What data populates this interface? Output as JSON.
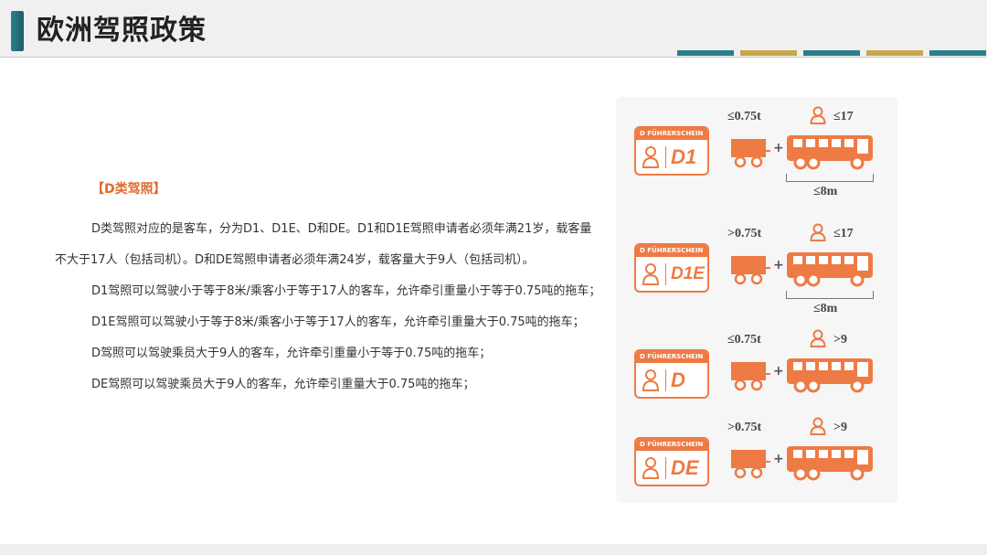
{
  "header": {
    "title": "欧洲驾照政策"
  },
  "stripes": [
    "#2a7f8a",
    "#c9a64a",
    "#2a7f8a",
    "#c9a64a",
    "#2a7f8a"
  ],
  "content": {
    "section_title": "【D类驾照】",
    "paragraphs": [
      "D类驾照对应的是客车，分为D1、D1E、D和DE。D1和D1E驾照申请者必须年满21岁，载客量不大于17人（包括司机）。D和DE驾照申请者必须年满24岁，载客量大于9人（包括司机）。",
      "D1驾照可以驾驶小于等于8米/乘客小于等于17人的客车，允许牵引重量小于等于0.75吨的拖车；",
      "D1E驾照可以驾驶小于等于8米/乘客小于等于17人的客车，允许牵引重量大于0.75吨的拖车；",
      "D驾照可以驾驶乘员大于9人的客车，允许牵引重量小于等于0.75吨的拖车；",
      "DE驾照可以驾驶乘员大于9人的客车，允许牵引重量大于0.75吨的拖车；"
    ]
  },
  "licenses": [
    {
      "header": "D  FÜHRERSCHEIN",
      "code": "D1",
      "trailer": "≤0.75t",
      "passengers": "≤17",
      "length": "≤8m"
    },
    {
      "header": "D  FÜHRERSCHEIN",
      "code": "D1E",
      "trailer": ">0.75t",
      "passengers": "≤17",
      "length": "≤8m"
    },
    {
      "header": "D  FÜHRERSCHEIN",
      "code": "D",
      "trailer": "≤0.75t",
      "passengers": ">9"
    },
    {
      "header": "D  FÜHRERSCHEIN",
      "code": "DE",
      "trailer": ">0.75t",
      "passengers": ">9"
    }
  ],
  "plus_sign": "+",
  "accent_color": "#ee7a44"
}
